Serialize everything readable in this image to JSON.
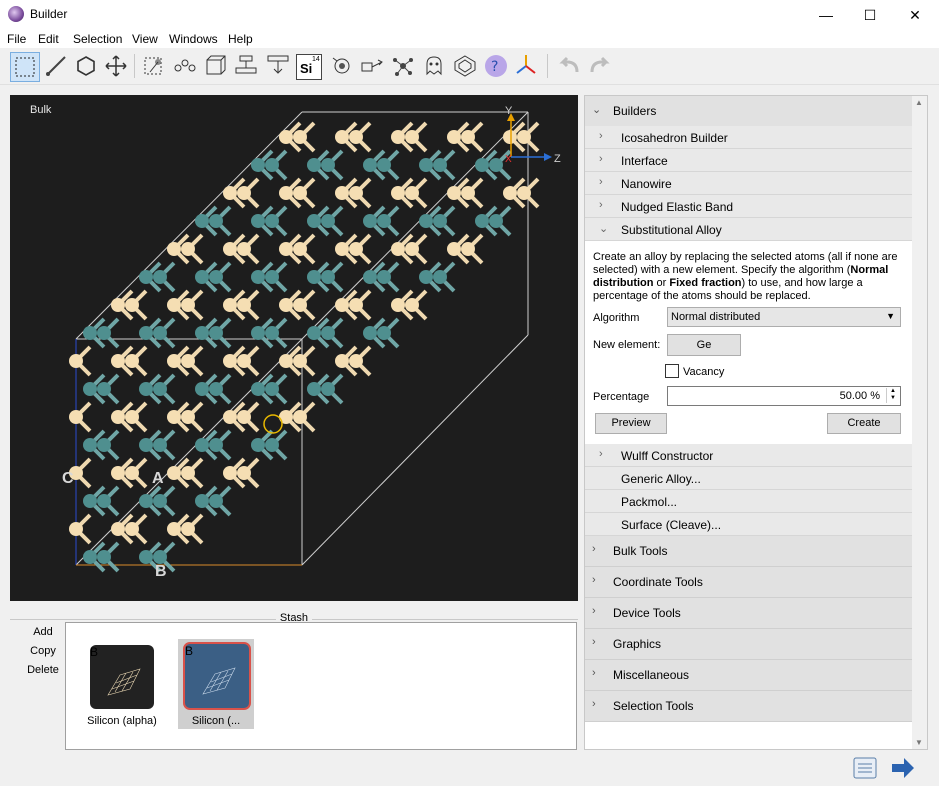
{
  "window": {
    "title": "Builder",
    "minimize": "—",
    "maximize": "☐",
    "close": "✕"
  },
  "menu": [
    "File",
    "Edit",
    "Selection",
    "View",
    "Windows",
    "Help"
  ],
  "toolbar": {
    "si_label": "Si",
    "si_number": "14"
  },
  "viewport": {
    "label": "Bulk",
    "axes": {
      "x": "X",
      "y": "Y",
      "z": "Z"
    },
    "lattice_labels": {
      "a": "A",
      "b": "B",
      "c": "C"
    }
  },
  "stash": {
    "title": "Stash",
    "actions": [
      "Add",
      "Copy",
      "Delete"
    ],
    "items": [
      {
        "badge": "B",
        "label": "Silicon (alpha)"
      },
      {
        "badge": "B",
        "label": "Silicon (..."
      }
    ]
  },
  "panel": {
    "builders": {
      "label": "Builders",
      "items": [
        "Icosahedron Builder",
        "Interface",
        "Nanowire",
        "Nudged Elastic Band",
        "Substitutional Alloy"
      ]
    },
    "alloy": {
      "desc_parts": [
        "Create an alloy by replacing the selected atoms (all if none are selected) with a new element. Specify the algorithm (",
        "Normal distribution",
        " or ",
        "Fixed fraction",
        ") to use, and how large a percentage of the atoms should be replaced."
      ],
      "algorithm_label": "Algorithm",
      "algorithm_value": "Normal distributed",
      "new_element_label": "New element:",
      "new_element_value": "Ge",
      "vacancy_label": "Vacancy",
      "percentage_label": "Percentage",
      "percentage_value": "50.00 %",
      "preview_label": "Preview",
      "create_label": "Create"
    },
    "more_items": [
      "Wulff Constructor",
      "Generic Alloy...",
      "Packmol...",
      "Surface (Cleave)..."
    ],
    "sections": [
      "Bulk Tools",
      "Coordinate Tools",
      "Device Tools",
      "Graphics",
      "Miscellaneous",
      "Selection Tools"
    ]
  },
  "colors": {
    "accent": "#0078d7",
    "silicon": "#f5deb3",
    "germanium": "#4f8f8f",
    "viewport_bg": "#1d1d1d"
  }
}
